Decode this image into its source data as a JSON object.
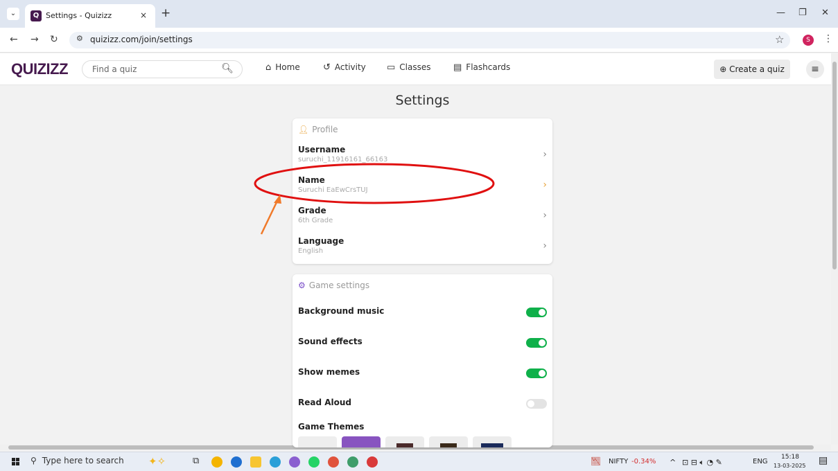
{
  "browser": {
    "tab_title": "Settings - Quizizz",
    "tab_close": "×",
    "new_tab": "+",
    "url": "quizizz.com/join/settings",
    "profile_initial": "S"
  },
  "header": {
    "logo": "QUIZIZZ",
    "search_placeholder": "Find a quiz",
    "nav": {
      "home": "Home",
      "activity": "Activity",
      "classes": "Classes",
      "flashcards": "Flashcards"
    },
    "create_quiz": "Create a quiz"
  },
  "page": {
    "title": "Settings"
  },
  "profile": {
    "header": "Profile",
    "rows": [
      {
        "label": "Username",
        "value": "suruchi_11916161_66163"
      },
      {
        "label": "Name",
        "value": "Suruchi EaEwCrsTUJ"
      },
      {
        "label": "Grade",
        "value": "6th Grade"
      },
      {
        "label": "Language",
        "value": "English"
      }
    ]
  },
  "game_settings": {
    "header": "Game settings",
    "toggles": [
      {
        "label": "Background music",
        "on": true
      },
      {
        "label": "Sound effects",
        "on": true
      },
      {
        "label": "Show memes",
        "on": true
      },
      {
        "label": "Read Aloud",
        "on": false
      }
    ],
    "themes_label": "Game Themes"
  },
  "taskbar": {
    "search_placeholder": "Type here to search",
    "nifty_label": "NIFTY",
    "nifty_change": "-0.34%",
    "language": "ENG",
    "time": "15:18",
    "date": "13-03-2025"
  },
  "colors": {
    "brand": "#461a4e",
    "toggle_on": "#0fb04a",
    "annotation_red": "#e01010",
    "annotation_arrow": "#f07a2a"
  }
}
